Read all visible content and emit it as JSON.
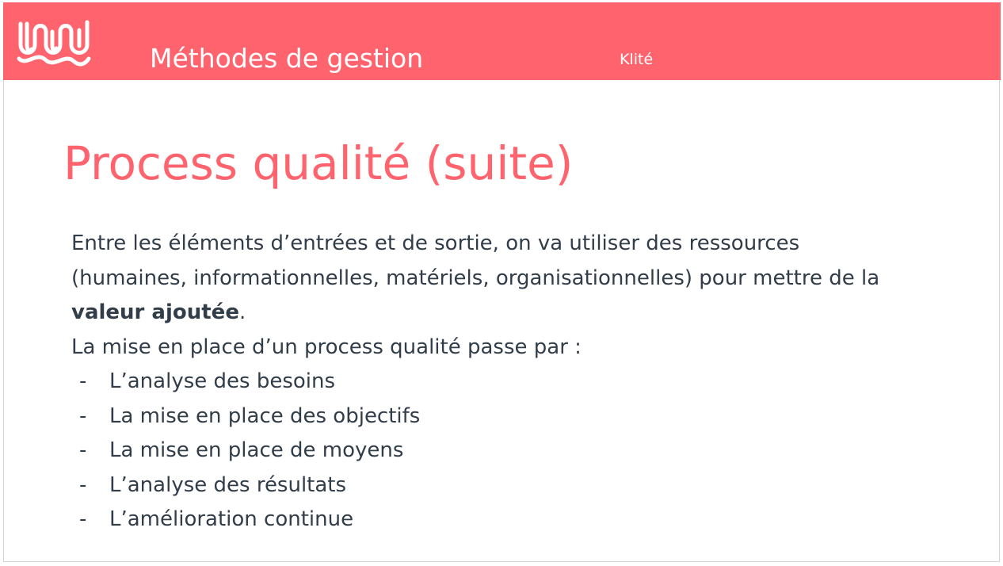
{
  "header": {
    "title": "Méthodes de gestion",
    "brand": "Klité",
    "logo_icon": "wave-squiggle-logo-icon",
    "band_color": "#ff646e"
  },
  "slide": {
    "title": "Process qualité (suite)",
    "title_color": "#ff646e",
    "paragraph": {
      "line1": "Entre les éléments d’entrées et de sortie, on va utiliser des ressources",
      "line2": "(humaines, informationnelles, matériels, organisationnelles) pour mettre de la",
      "bold": "valeur ajoutée",
      "after_bold": "."
    },
    "intro": "La mise en place d’un process qualité passe par :",
    "bullet_marker": "-",
    "bullets": [
      "L’analyse des besoins",
      "La mise en place des objectifs",
      "La mise en place de moyens",
      "L’analyse des résultats",
      "L’amélioration continue"
    ]
  }
}
